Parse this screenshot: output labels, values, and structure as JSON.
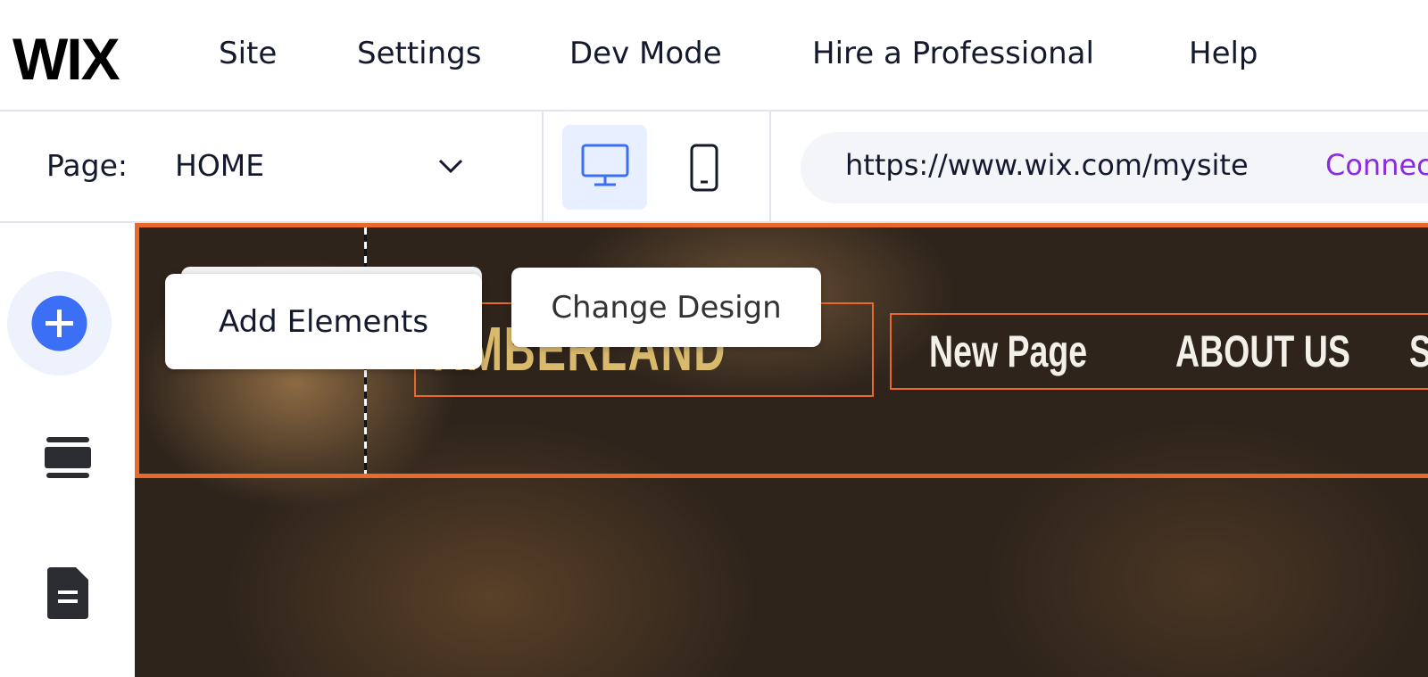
{
  "topbar": {
    "logo": "WIX",
    "menu": [
      "Site",
      "Settings",
      "Dev Mode",
      "Hire a Professional",
      "Help"
    ]
  },
  "pagebar": {
    "page_label": "Page:",
    "page_value": "HOME",
    "url": "https://www.wix.com/mysite",
    "connect": "Connect"
  },
  "sidebar": {
    "icons": [
      "add-icon",
      "strips-icon",
      "pages-icon"
    ]
  },
  "tooltips": {
    "add": "Add Elements",
    "design": "Change Design"
  },
  "site": {
    "logo_text": "TIMBERLAND",
    "nav": [
      "New Page",
      "ABOUT US",
      "S"
    ]
  },
  "colors": {
    "accent": "#3b6ff5",
    "selection": "#e8692a",
    "connect": "#8a2be2"
  }
}
